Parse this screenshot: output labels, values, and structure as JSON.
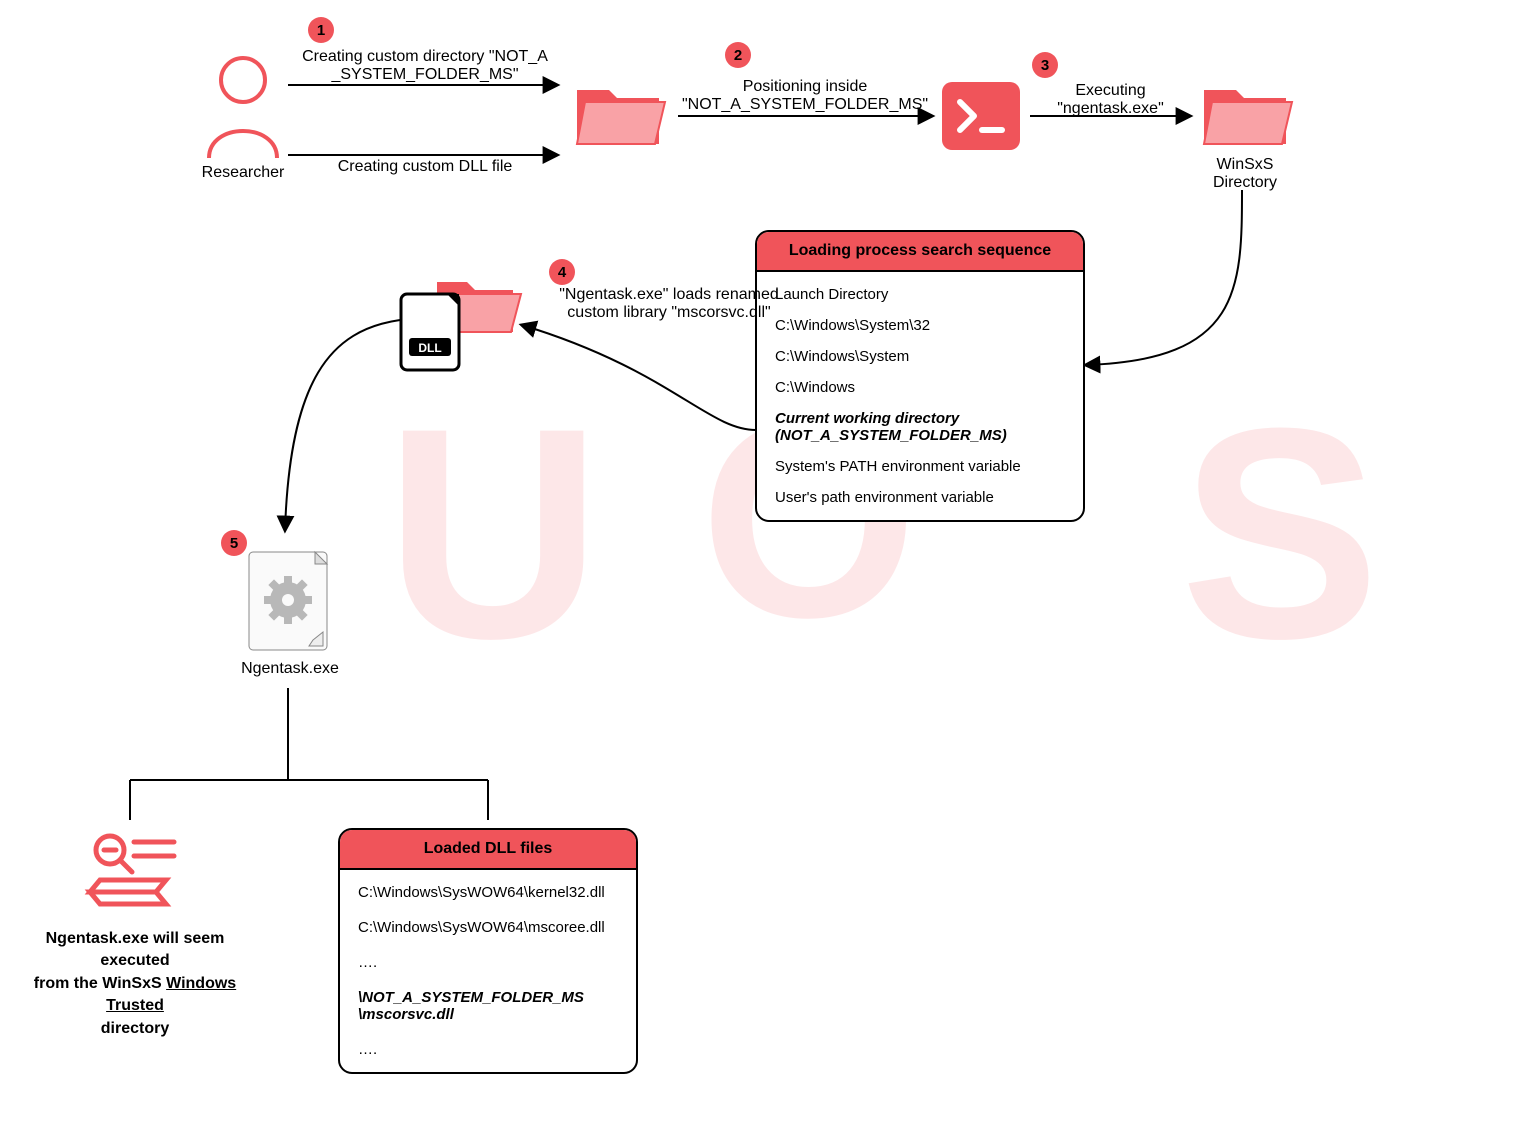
{
  "steps": {
    "s1": "1",
    "s2": "2",
    "s3": "3",
    "s4": "4",
    "s5": "5"
  },
  "actors": {
    "researcher": "Researcher",
    "winsxs": "WinSxS\nDirectory",
    "ngentask": "Ngentask.exe"
  },
  "edges": {
    "create_dir_1": "Creating custom directory \"NOT_A",
    "create_dir_2": "_SYSTEM_FOLDER_MS\"",
    "create_dll": "Creating custom DLL file",
    "positioning_1": "Positioning inside",
    "positioning_2": "\"NOT_A_SYSTEM_FOLDER_MS\"",
    "executing_1": "Executing",
    "executing_2": "\"ngentask.exe\"",
    "load_lib_1": "\"Ngentask.exe\" loads renamed",
    "load_lib_2": "custom library \"mscorsvc.dll\""
  },
  "search_panel": {
    "title": "Loading process search sequence",
    "items": [
      "Launch Directory",
      "C:\\Windows\\System\\32",
      "C:\\Windows\\System",
      "C:\\Windows",
      "Current working directory\n(NOT_A_SYSTEM_FOLDER_MS)",
      "System's PATH environment variable",
      "User's path environment variable"
    ]
  },
  "loaded_panel": {
    "title": "Loaded DLL files",
    "items": [
      "C:\\Windows\\SysWOW64\\kernel32.dll",
      "C:\\Windows\\SysWOW64\\mscoree.dll",
      "….",
      "\\NOT_A_SYSTEM_FOLDER_MS\n\\mscorsvc.dll",
      "…."
    ]
  },
  "result": {
    "line1": "Ngentask.exe will seem executed",
    "line2_pre": "from the WinSxS ",
    "line2_u": "Windows Trusted",
    "line3": "directory"
  },
  "watermark": {
    "a": "U",
    "b": "O",
    "c": "S"
  }
}
